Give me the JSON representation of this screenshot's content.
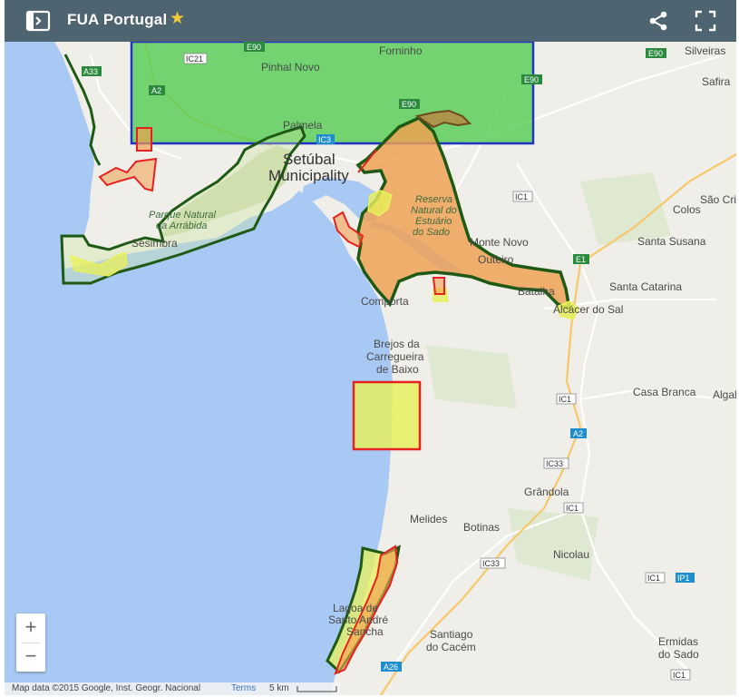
{
  "header": {
    "title": "FUA Portugal",
    "star": "★",
    "library_icon": "library-toggle-icon",
    "share_icon": "share-icon",
    "fullscreen_icon": "fullscreen-icon"
  },
  "map": {
    "places": {
      "pinhal_novo": "Pinhal Novo",
      "forninho": "Forninho",
      "silveiras": "Silveiras",
      "safira": "Safira",
      "palmela": "Palmela",
      "setubal_1": "Setúbal",
      "setubal_2": "Municipality",
      "sesimbra": "Sesimbra",
      "park_1": "Parque Natural",
      "park_2": "da Arrábida",
      "reserva_1": "Reserva",
      "reserva_2": "Natural do",
      "reserva_3": "Estuário",
      "reserva_4": "do Sado",
      "monte_novo_1": "Monte Novo",
      "monte_novo_2": "Outeiro",
      "colos": "Colos",
      "sao_cr": "São Cri",
      "santa_susana": "Santa Susana",
      "santa_catarina": "Santa Catarina",
      "comporta": "Comporta",
      "batalha": "Batalha",
      "alcacer": "Alcácer do Sal",
      "brejos_1": "Brejos da",
      "brejos_2": "Carregueira",
      "brejos_3": "de Baixo",
      "casa_branca": "Casa Branca",
      "algal": "Algal",
      "grandola": "Grândola",
      "melides": "Melides",
      "botinas": "Botinas",
      "nicolau": "Nicolau",
      "lagoa_1": "Lagoa de",
      "lagoa_2": "Santo André",
      "lagoa_3": "Sancha",
      "santiago_1": "Santiago",
      "santiago_2": "do Cacém",
      "ermidas_1": "Ermidas",
      "ermidas_2": "do Sado"
    },
    "road_shields": {
      "a33": "A33",
      "ic21": "IC21",
      "e90_a": "E90",
      "a2_a": "A2",
      "e90_b": "E90",
      "ic3": "IC3",
      "e90_c": "E90",
      "e90_d": "E90",
      "ic1_a": "IC1",
      "e1": "E1",
      "ic1_b": "IC1",
      "a2_b": "A2",
      "ic33_a": "IC33",
      "ic1_c": "IC1",
      "ic33_b": "IC33",
      "ic1_d": "IC1",
      "ip1": "IP1",
      "a26": "A26",
      "ic1_e": "IC1"
    },
    "colors": {
      "sea": "#a9c9f5",
      "land": "#efeee8",
      "green_fill": "#4fcc4f",
      "blue_outline": "#1f34c4",
      "dark_green_outline": "#1e5a14",
      "red_outline": "#e52121",
      "orange_fill": "#f0a050",
      "yellow_fill": "#e8f05a"
    }
  },
  "controls": {
    "zoom_in": "+",
    "zoom_out": "−"
  },
  "attribution": {
    "data": "Map data ©2015 Google, Inst. Geogr. Nacional",
    "terms": "Terms",
    "scale": "5 km"
  }
}
